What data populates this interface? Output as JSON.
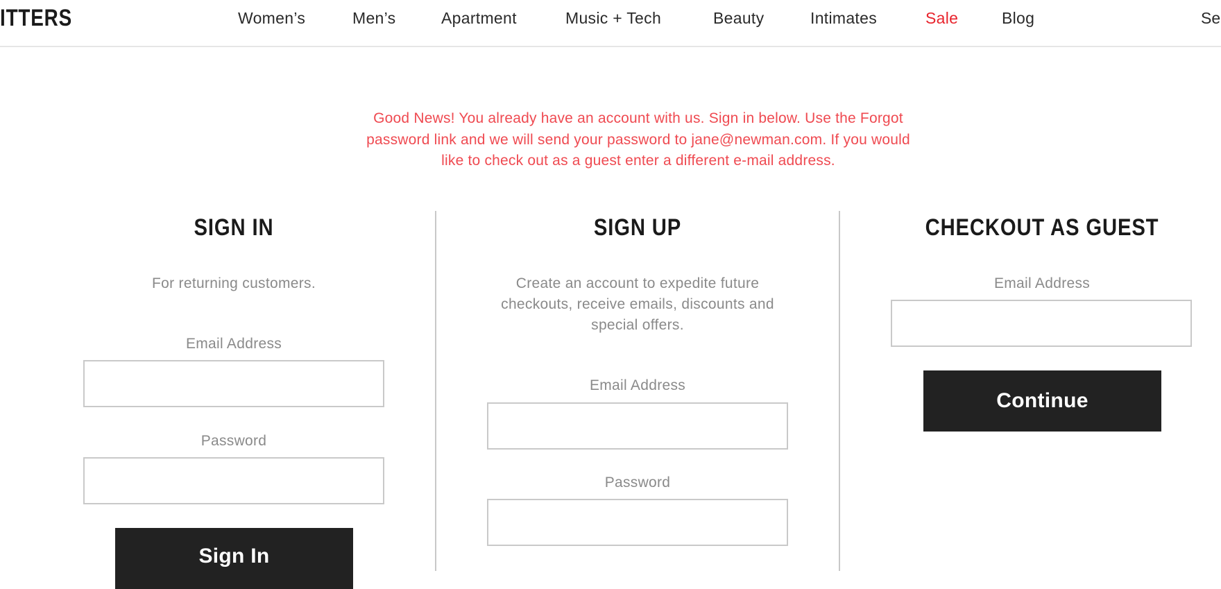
{
  "header": {
    "brand": "ITTERS",
    "nav": [
      {
        "label": "Women’s"
      },
      {
        "label": "Men’s"
      },
      {
        "label": "Apartment"
      },
      {
        "label": "Music + Tech"
      },
      {
        "label": "Beauty"
      },
      {
        "label": "Intimates"
      },
      {
        "label": "Sale"
      },
      {
        "label": "Blog"
      }
    ],
    "search_partial": "Se"
  },
  "notice": {
    "lines": [
      "Good News! You already have an account with us. Sign in below. Use the Forgot",
      "password link and we will send your password to jane@newman.com. If you would",
      "like to check out as a guest enter a different e-mail address."
    ]
  },
  "sign_in": {
    "title": "SIGN IN",
    "description": "For returning customers.",
    "email_label": "Email Address",
    "email_value": "",
    "password_label": "Password",
    "password_value": "",
    "button_label": "Sign In"
  },
  "sign_up": {
    "title": "SIGN UP",
    "description_lines": [
      "Create an account to expedite future",
      "checkouts, receive emails, discounts and",
      "special offers."
    ],
    "email_label": "Email Address",
    "email_value": "",
    "password_label": "Password",
    "password_value": ""
  },
  "guest": {
    "title": "CHECKOUT AS GUEST",
    "email_label": "Email Address",
    "email_value": "",
    "button_label": "Continue"
  },
  "colors": {
    "notice": "#ef4a51",
    "sale": "#e8242d",
    "button_bg": "#222222",
    "divider": "#c8c8c8"
  }
}
